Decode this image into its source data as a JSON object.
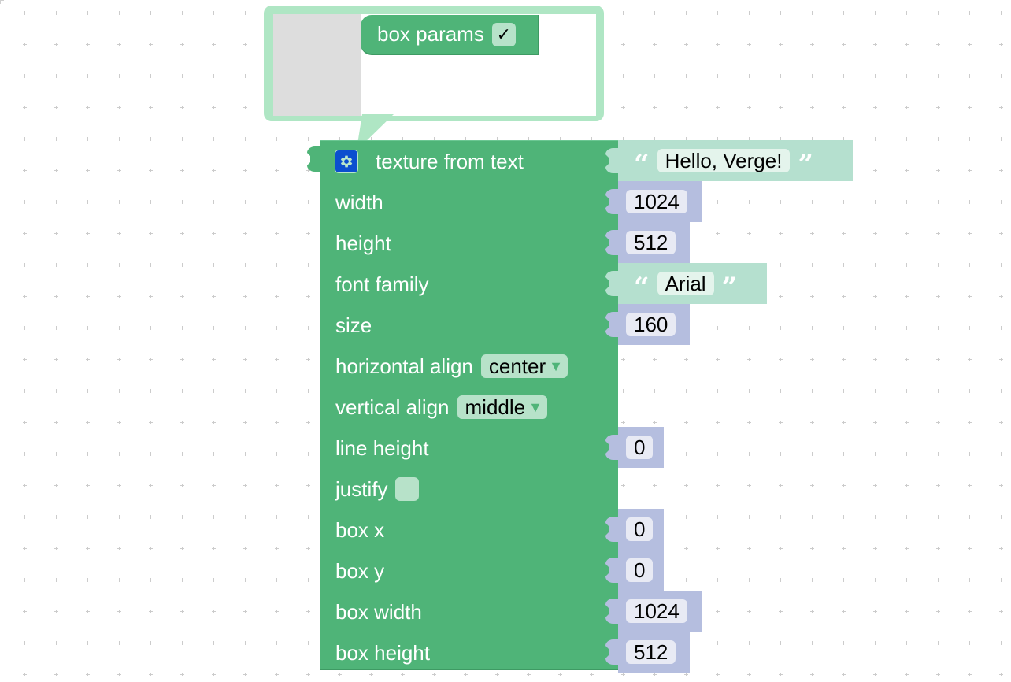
{
  "colors": {
    "block": "#4fb478",
    "number_block": "#b5bedf",
    "text_block": "#b5e0cf",
    "bubble": "#afe6c4",
    "gear_button": "#0b4fcf"
  },
  "mutator": {
    "flyout_label": "",
    "item": {
      "label": "box params",
      "checked": true,
      "check_glyph": "✓"
    }
  },
  "block": {
    "title": "texture from text",
    "icon": "gear-icon",
    "rows": [
      {
        "label": "width"
      },
      {
        "label": "height"
      },
      {
        "label": "font family"
      },
      {
        "label": "size"
      },
      {
        "label": "horizontal align",
        "dropdown": "center"
      },
      {
        "label": "vertical align",
        "dropdown": "middle"
      },
      {
        "label": "line height"
      },
      {
        "label": "justify",
        "checkbox": false
      },
      {
        "label": "box x"
      },
      {
        "label": "box y"
      },
      {
        "label": "box width"
      },
      {
        "label": "box height"
      }
    ],
    "dropdown_arrow": "▼"
  },
  "inputs": {
    "text": {
      "type": "text",
      "value": "Hello, Verge!"
    },
    "width": {
      "type": "number",
      "value": "1024"
    },
    "height": {
      "type": "number",
      "value": "512"
    },
    "font_family": {
      "type": "text",
      "value": "Arial"
    },
    "size": {
      "type": "number",
      "value": "160"
    },
    "line_height": {
      "type": "number",
      "value": "0"
    },
    "box_x": {
      "type": "number",
      "value": "0"
    },
    "box_y": {
      "type": "number",
      "value": "0"
    },
    "box_width": {
      "type": "number",
      "value": "1024"
    },
    "box_height": {
      "type": "number",
      "value": "512"
    }
  },
  "quotes": {
    "open": "“",
    "close": "”"
  }
}
